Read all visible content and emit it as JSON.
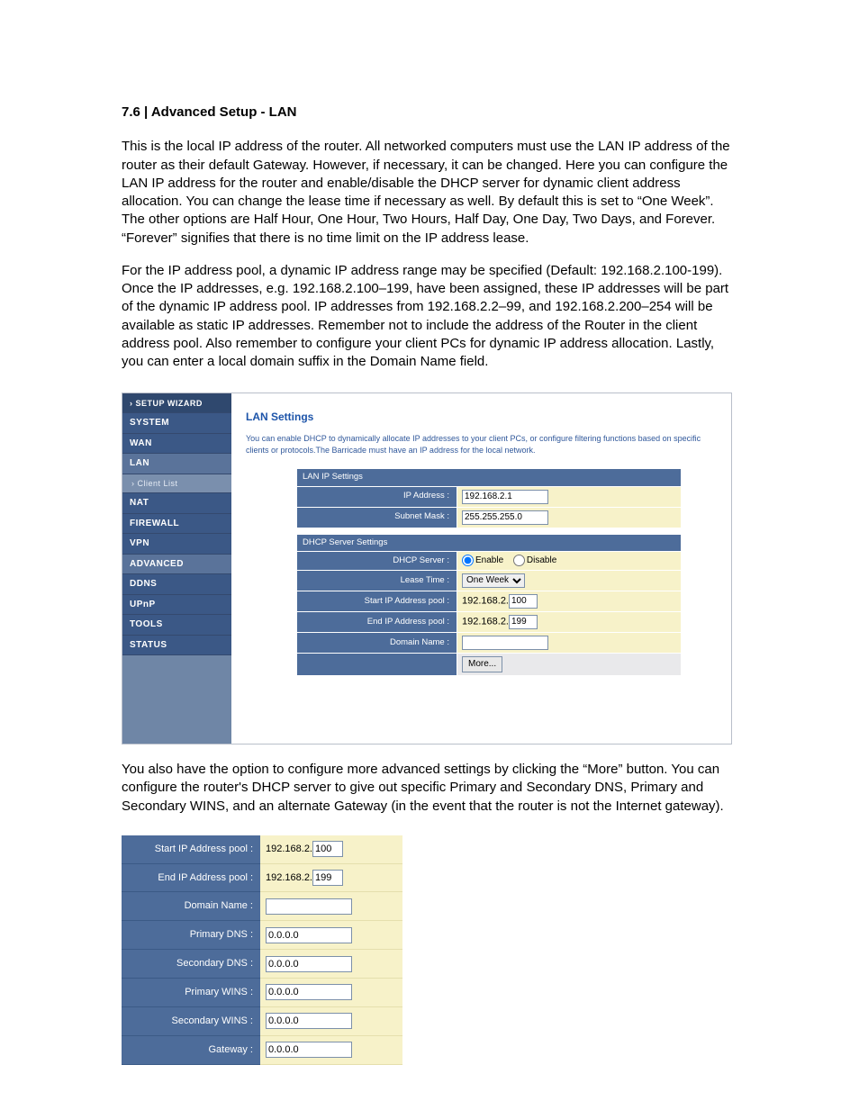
{
  "doc": {
    "heading": "7.6 | Advanced Setup - LAN",
    "p1": "This is the local IP address of the router. All networked computers must use the LAN IP address of the router as their default Gateway. However, if necessary, it can be changed. Here you can configure the LAN IP address for the router and enable/disable the DHCP server for dynamic client address allocation. You can change the lease time if necessary as well. By default this is set to “One Week”. The other options are Half Hour, One Hour, Two Hours, Half Day, One Day, Two Days, and Forever. “Forever” signifies that there is no time limit on the IP address lease.",
    "p2": "For the IP address pool, a dynamic IP address range may be specified (Default: 192.168.2.100-199). Once the IP addresses, e.g. 192.168.2.100–199, have been assigned, these IP addresses will be part of the dynamic IP address pool. IP addresses from 192.168.2.2–99, and 192.168.2.200–254 will be available as static IP addresses. Remember not to include the address of the Router in the client address pool. Also remember to configure your client PCs for dynamic IP address allocation. Lastly, you can enter a local domain suffix in the Domain Name field.",
    "p3": "You also have the option to configure more advanced settings by clicking the “More” button. You can configure the router's DHCP server to give out specific Primary and Secondary DNS, Primary and Secondary WINS, and an alternate Gateway (in the event that the router is not the Internet gateway)."
  },
  "ui": {
    "nav": {
      "setup_wizard": "SETUP WIZARD",
      "system": "SYSTEM",
      "wan": "WAN",
      "lan": "LAN",
      "client_list": "Client List",
      "nat": "NAT",
      "firewall": "FIREWALL",
      "vpn": "VPN",
      "advanced": "ADVANCED",
      "ddns": "DDNS",
      "upnp": "UPnP",
      "tools": "TOOLS",
      "status": "STATUS"
    },
    "title": "LAN Settings",
    "desc": "You can enable DHCP to dynamically allocate IP addresses to your client PCs, or configure filtering functions based on specific clients or protocols.The Barricade must have an IP address for the local network.",
    "section_lan_ip": "LAN IP Settings",
    "section_dhcp": "DHCP Server Settings",
    "labels": {
      "ip_address": "IP Address :",
      "subnet_mask": "Subnet Mask :",
      "dhcp_server": "DHCP Server :",
      "lease_time": "Lease Time :",
      "start_pool": "Start IP Address pool :",
      "end_pool": "End IP Address pool :",
      "domain_name": "Domain Name :",
      "enable": "Enable",
      "disable": "Disable",
      "more": "More...",
      "primary_dns": "Primary DNS :",
      "secondary_dns": "Secondary DNS :",
      "primary_wins": "Primary WINS :",
      "secondary_wins": "Secondary WINS :",
      "gateway": "Gateway :"
    },
    "values": {
      "ip_address": "192.168.2.1",
      "subnet_mask": "255.255.255.0",
      "dhcp_server": "enable",
      "lease_time": "One Week",
      "ip_prefix": "192.168.2.",
      "start_pool_octet": "100",
      "end_pool_octet": "199",
      "domain_name": "",
      "primary_dns": "0.0.0.0",
      "secondary_dns": "0.0.0.0",
      "primary_wins": "0.0.0.0",
      "secondary_wins": "0.0.0.0",
      "gateway": "0.0.0.0"
    }
  }
}
